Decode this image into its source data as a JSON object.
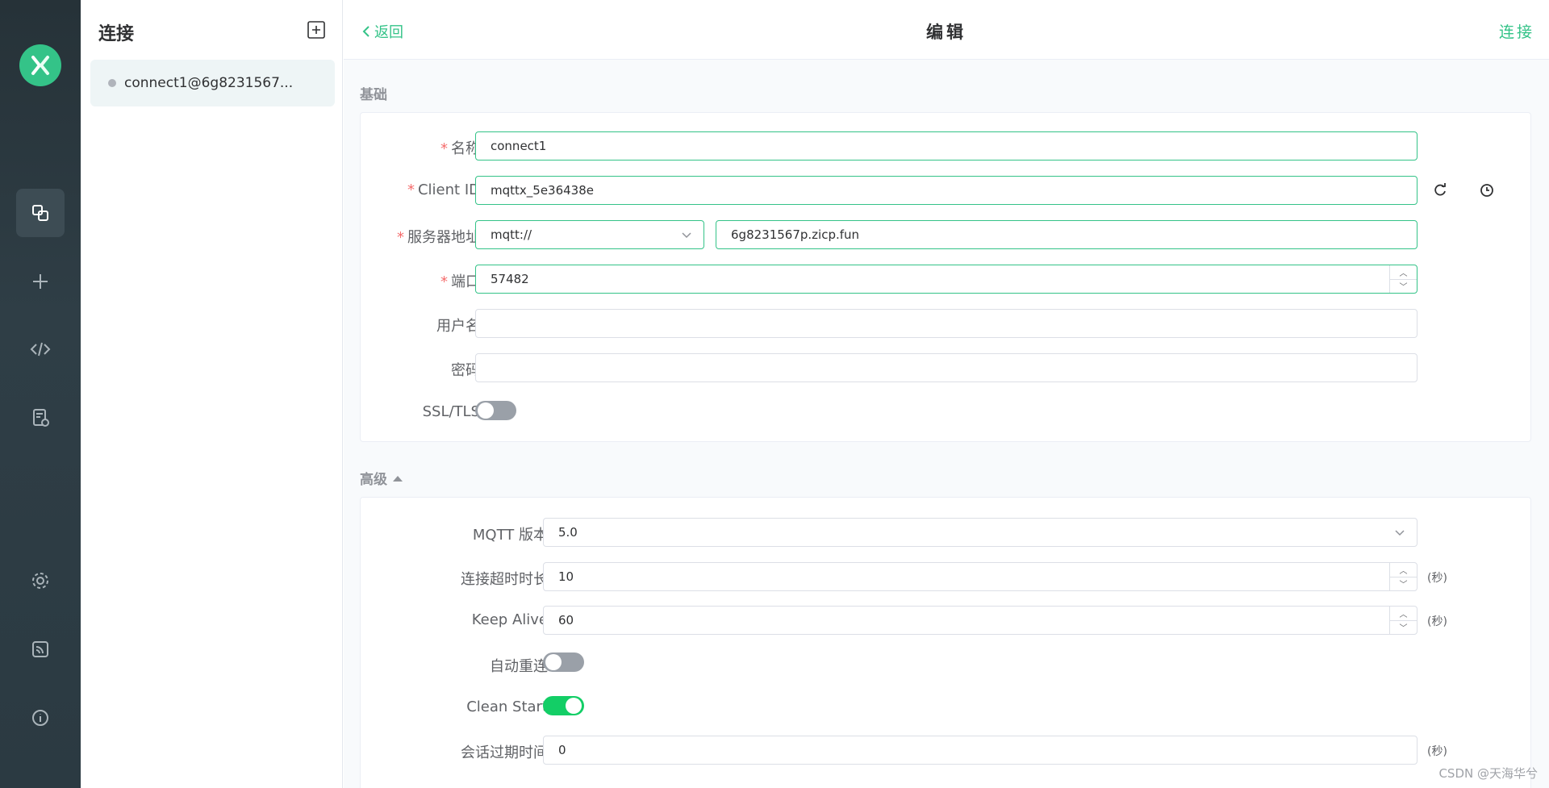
{
  "sidebar_rail": {
    "items": [
      "connections-icon",
      "add-icon",
      "code-icon",
      "log-icon",
      "settings-icon",
      "feed-icon",
      "info-icon"
    ]
  },
  "connections": {
    "title": "连接",
    "items": [
      {
        "name": "connect1@6g8231567..."
      }
    ]
  },
  "header": {
    "back": "返回",
    "title": "编辑",
    "connect": "连接"
  },
  "basic": {
    "section_title": "基础",
    "name_label": "名称",
    "name_value": "connect1",
    "client_id_label": "Client ID",
    "client_id_value": "mqttx_5e36438e",
    "host_label": "服务器地址",
    "protocol_value": "mqtt://",
    "host_value": "6g8231567p.zicp.fun",
    "port_label": "端口",
    "port_value": "57482",
    "username_label": "用户名",
    "username_value": "",
    "password_label": "密码",
    "password_value": "",
    "ssl_label": "SSL/TLS",
    "ssl_on": false
  },
  "advanced": {
    "section_title": "高级",
    "mqtt_version_label": "MQTT 版本",
    "mqtt_version_value": "5.0",
    "connect_timeout_label": "连接超时时长",
    "connect_timeout_value": "10",
    "keep_alive_label": "Keep Alive",
    "keep_alive_value": "60",
    "unit_seconds": "(秒)",
    "auto_reconnect_label": "自动重连",
    "auto_reconnect_on": false,
    "clean_start_label": "Clean Start",
    "clean_start_on": true,
    "session_expiry_label": "会话过期时间",
    "session_expiry_value": "0"
  },
  "watermark": "CSDN @天海华兮",
  "colors": {
    "accent": "#34c388",
    "switch_on": "#13ce66",
    "required": "#f56c6c",
    "rail": "#2b3a42"
  }
}
